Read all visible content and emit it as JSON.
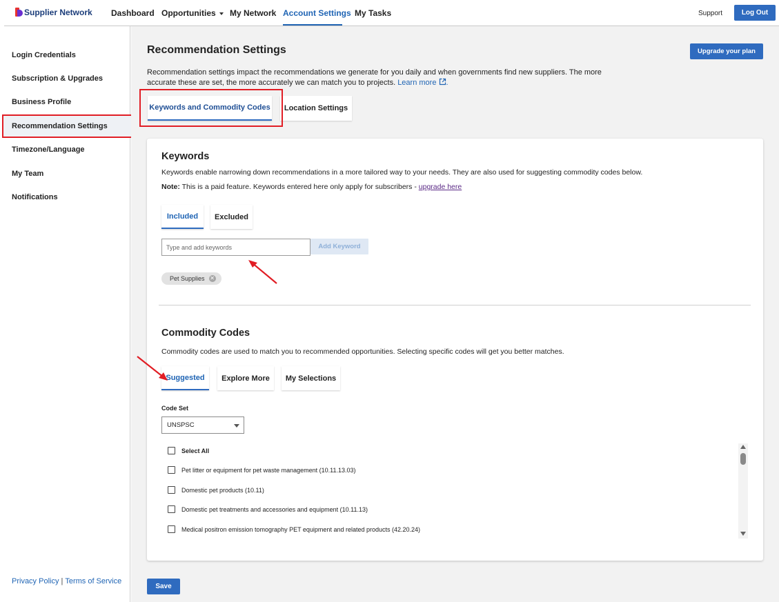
{
  "header": {
    "logo_text": "Supplier Network",
    "nav": [
      {
        "label": "Dashboard"
      },
      {
        "label": "Opportunities"
      },
      {
        "label": "My Network"
      },
      {
        "label": "Account Settings"
      },
      {
        "label": "My Tasks"
      }
    ],
    "support": "Support",
    "logout": "Log Out"
  },
  "sidebar": {
    "items": [
      {
        "label": "Login Credentials"
      },
      {
        "label": "Subscription & Upgrades"
      },
      {
        "label": "Business Profile"
      },
      {
        "label": "Recommendation Settings"
      },
      {
        "label": "Timezone/Language"
      },
      {
        "label": "My Team"
      },
      {
        "label": "Notifications"
      }
    ],
    "privacy": "Privacy Policy",
    "separator": "|",
    "terms": "Terms of Service"
  },
  "main": {
    "title": "Recommendation Settings",
    "upgrade_button": "Upgrade your plan",
    "description": "Recommendation settings impact the recommendations we generate for you daily and when governments find new suppliers. The more accurate these are set, the more accurately we can match you to projects.",
    "learn_more": "Learn more",
    "tabs": [
      {
        "label": "Keywords and Commodity Codes"
      },
      {
        "label": "Location Settings"
      }
    ],
    "keywords": {
      "title": "Keywords",
      "description": "Keywords enable narrowing down recommendations in a more tailored way to your needs. They are also used for suggesting commodity codes below.",
      "note_label": "Note:",
      "note_text": "This is a paid feature. Keywords entered here only apply for subscribers -",
      "note_link": "upgrade here",
      "tabs": [
        {
          "label": "Included"
        },
        {
          "label": "Excluded"
        }
      ],
      "input_placeholder": "Type and add keywords",
      "add_button": "Add Keyword",
      "chips": [
        "Pet Supplies"
      ]
    },
    "commodity": {
      "title": "Commodity Codes",
      "description": "Commodity codes are used to match you to recommended opportunities. Selecting specific codes will get you better matches.",
      "tabs": [
        {
          "label": "Suggested"
        },
        {
          "label": "Explore More"
        },
        {
          "label": "My Selections"
        }
      ],
      "code_set_label": "Code Set",
      "code_set_value": "UNSPSC",
      "select_all": "Select All",
      "items": [
        {
          "label": "Pet litter or equipment for pet waste management (10.11.13.03)"
        },
        {
          "label": "Domestic pet products (10.11)"
        },
        {
          "label": "Domestic pet treatments and accessories and equipment (10.11.13)"
        },
        {
          "label": "Medical positron emission tomography PET equipment and related products (42.20.24)"
        }
      ]
    },
    "save_button": "Save"
  },
  "colors": {
    "primary": "#2f6bbf",
    "link": "#1f64b4",
    "highlight_red": "#e11d24"
  }
}
